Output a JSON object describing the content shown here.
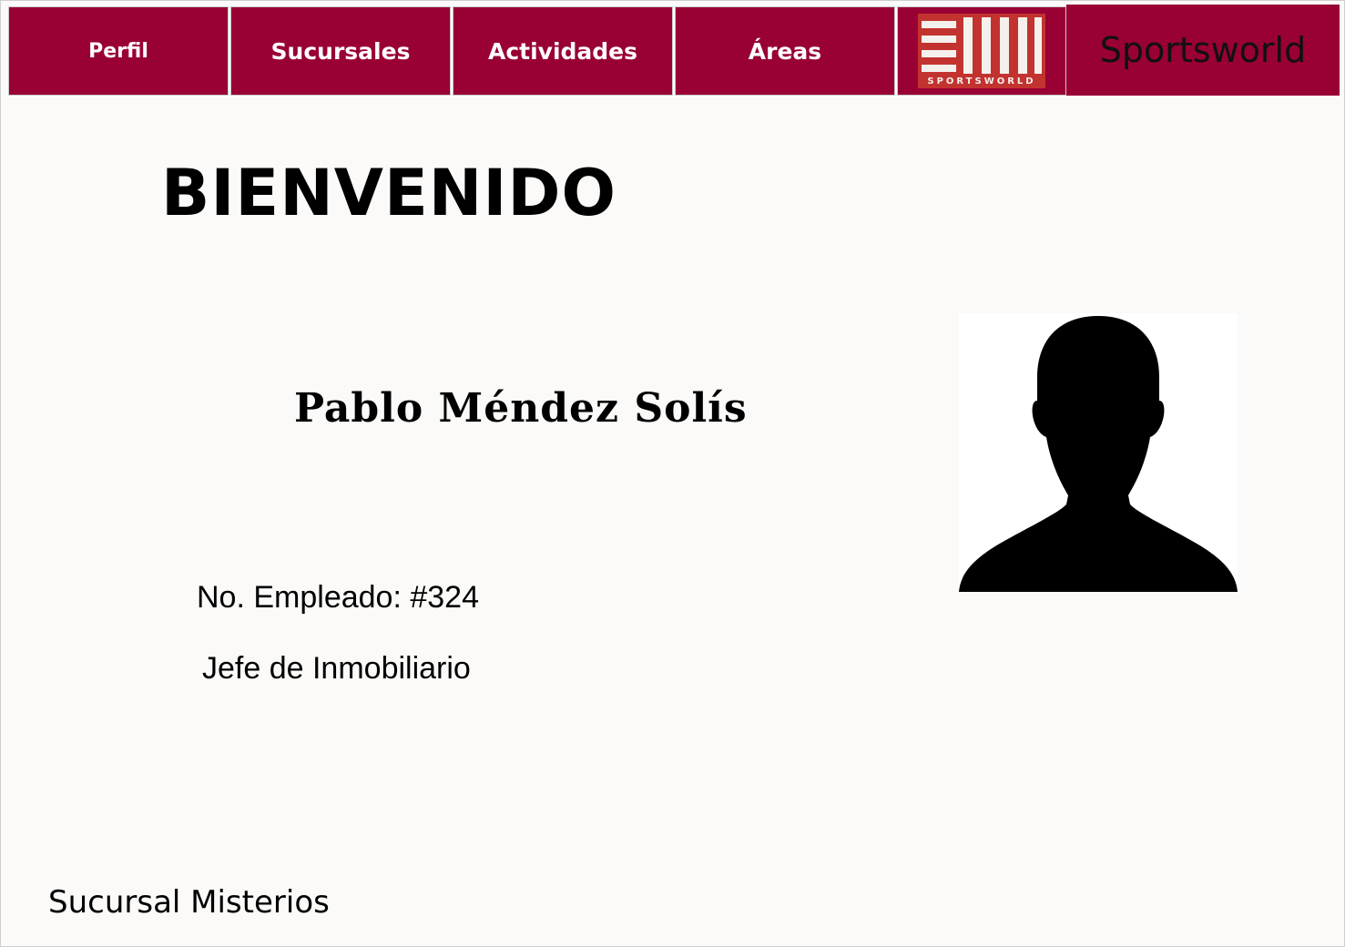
{
  "nav": {
    "items": [
      {
        "label": "Perfil"
      },
      {
        "label": "Sucursales"
      },
      {
        "label": "Actividades"
      },
      {
        "label": "Áreas"
      }
    ],
    "logo_text": "SPORTSWORLD",
    "brand": "Sportsworld"
  },
  "profile": {
    "welcome": "BIENVENIDO",
    "name": "Pablo Méndez Solís",
    "employee_no": "No. Empleado: #324",
    "role": "Jefe de Inmobiliario",
    "branch": "Sucursal Misterios"
  },
  "colors": {
    "nav_bg": "#990033",
    "logo_red": "#c2332f",
    "page_bg": "#fbfaf8"
  },
  "icons": {
    "avatar": "user-silhouette-icon",
    "logo": "sportsworld-logo"
  }
}
